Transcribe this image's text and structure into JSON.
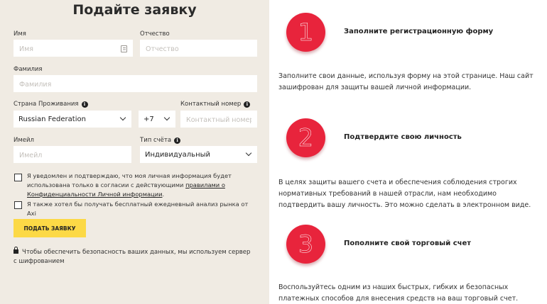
{
  "form": {
    "title": "Подайте заявку",
    "first_name": {
      "label": "Имя",
      "placeholder": "Имя"
    },
    "patronymic": {
      "label": "Отчество",
      "placeholder": "Отчество"
    },
    "last_name": {
      "label": "Фамилия",
      "placeholder": "Фамилия"
    },
    "country": {
      "label": "Страна Проживания",
      "value": "Russian Federation"
    },
    "phone_code": {
      "value": "+7"
    },
    "phone": {
      "label": "Контактный номер",
      "placeholder": "Контактный номер"
    },
    "email": {
      "label": "Имейл",
      "placeholder": "Имейл"
    },
    "account_type": {
      "label": "Тип счёта",
      "value": "Индивидуальный"
    },
    "consent": {
      "text_1": "Я уведомлен и подтверждаю, что моя личная информация будет использована только в согласии с действующими ",
      "link_1": "правилами о Конфиденциальности Личной информации",
      "text_2": "."
    },
    "newsletter": {
      "text": "Я также хотел бы получать бесплатный ежедневный анализ рынка от Axi"
    },
    "submit_label": "ПОДАТЬ ЗАЯВКУ",
    "secure_note": "Чтобы обеспечить безопасность ваших данных, мы используем сервер с шифрованием"
  },
  "steps": [
    {
      "number": "1",
      "title": "Заполните регистрационную форму",
      "text": "Заполните свои данные, используя форму на этой странице. Наш сайт зашифрован для защиты вашей личной информации."
    },
    {
      "number": "2",
      "title": "Подтвердите свою личность",
      "text": "В целях защиты вашего счета и обеспечения соблюдения строгих нормативных требований в нашей отрасли, нам необходимо подтвердить вашу личность. Это можно сделать в электронном виде."
    },
    {
      "number": "3",
      "title": "Пополните свой торговый счет",
      "text": "Воспользуйтесь одним из наших быстрых, гибких и безопасных платежных способов для внесения средств на ваш торговый счет."
    }
  ],
  "colors": {
    "panel_bg": "#f0ebe3",
    "accent_yellow": "#fcd946",
    "badge_red": "#e8243c"
  },
  "icons": {
    "info": "info-icon",
    "chevron": "chevron-down-icon",
    "card": "contact-card-icon",
    "lock": "lock-icon"
  }
}
